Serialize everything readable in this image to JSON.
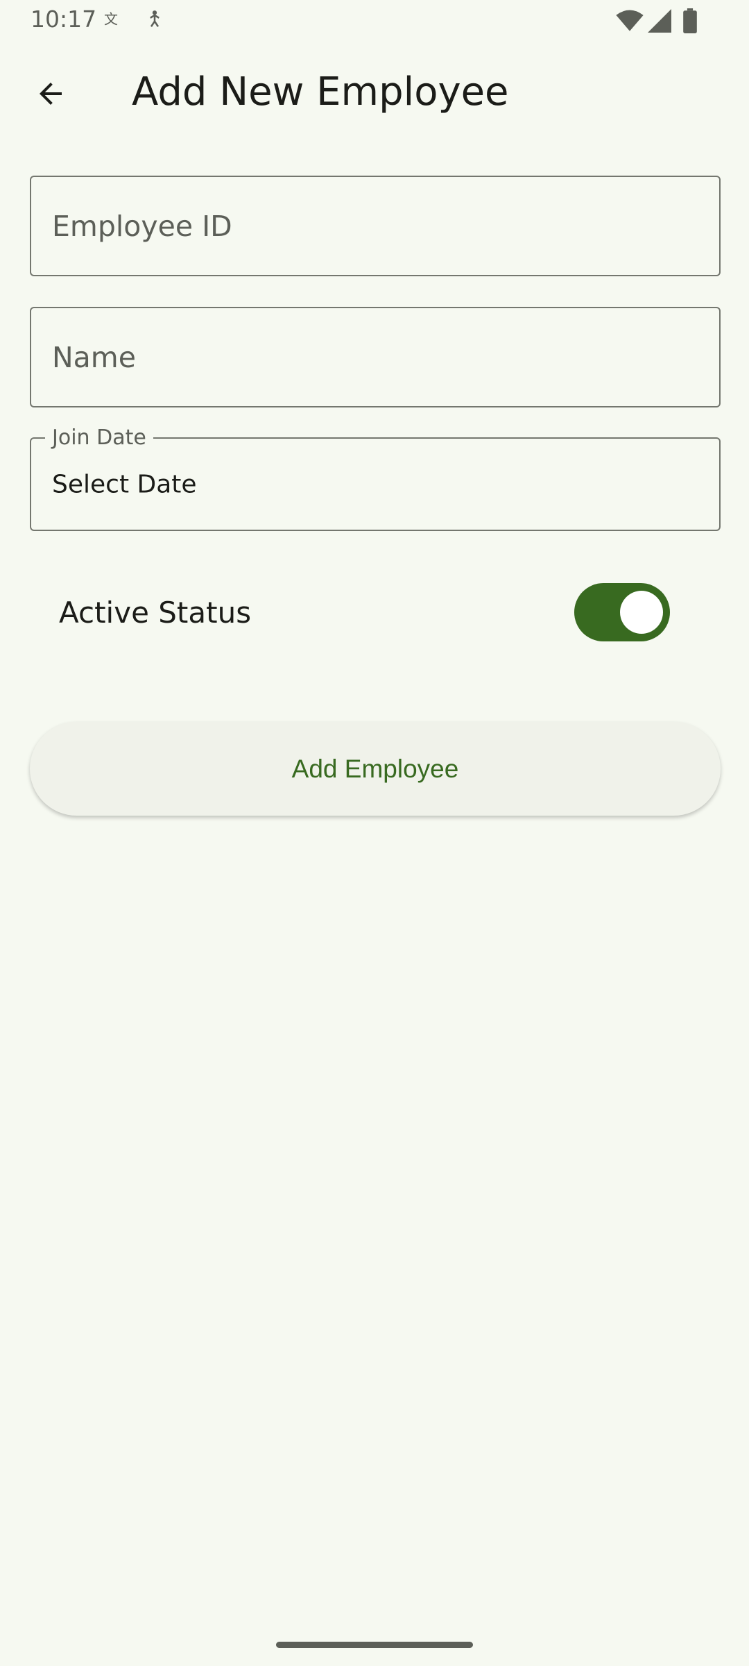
{
  "status_bar": {
    "time": "10:17",
    "left_icons": [
      "translate-icon",
      "accessibility-icon"
    ],
    "right_icons": [
      "wifi-icon",
      "signal-icon",
      "battery-icon"
    ]
  },
  "app_bar": {
    "back_icon": "arrow-back-icon",
    "title": "Add New Employee"
  },
  "form": {
    "employee_id": {
      "placeholder": "Employee ID",
      "value": ""
    },
    "name": {
      "placeholder": "Name",
      "value": ""
    },
    "join_date": {
      "label": "Join Date",
      "value": "Select Date"
    },
    "active_status": {
      "label": "Active Status",
      "checked": true
    },
    "submit_label": "Add Employee"
  },
  "colors": {
    "background": "#f6f9f1",
    "accent": "#386a20",
    "outline": "#74776f",
    "button_surface": "#f0f2ea"
  }
}
